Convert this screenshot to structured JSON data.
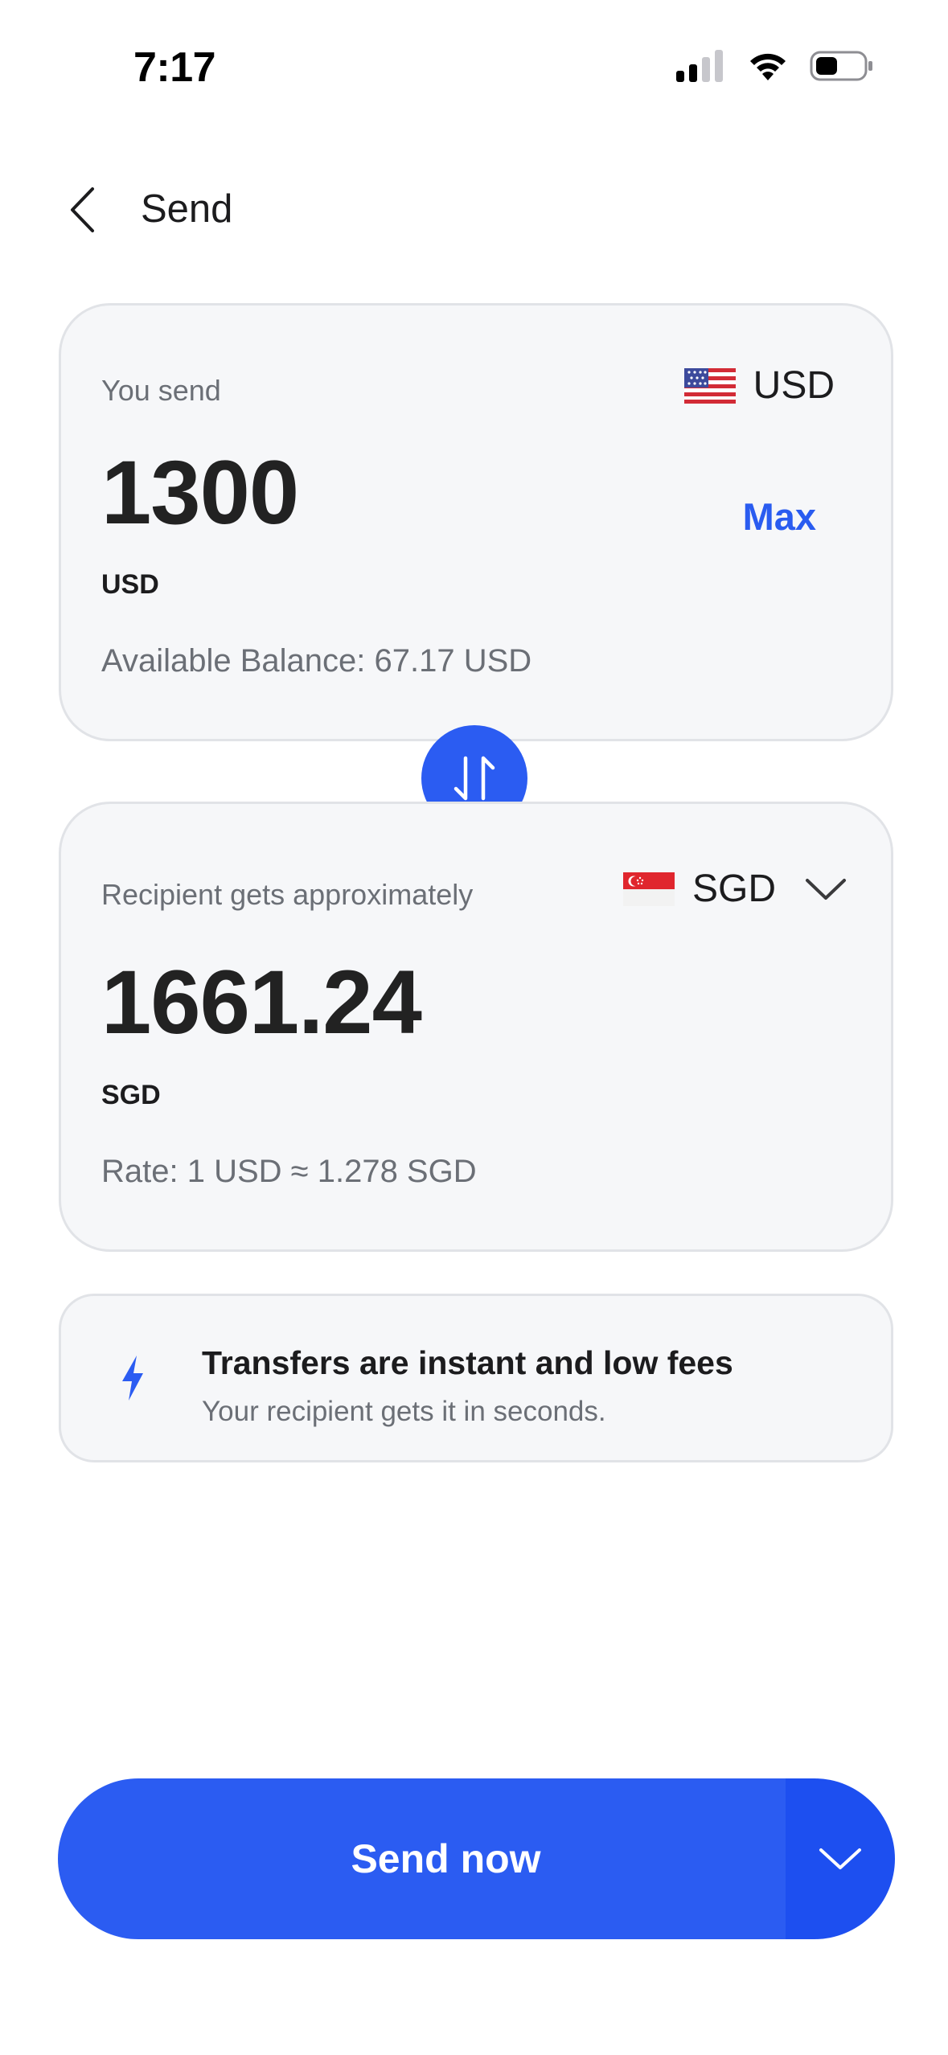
{
  "status_bar": {
    "time": "7:17",
    "icons": [
      "cellular-signal-icon",
      "wifi-icon",
      "battery-icon"
    ]
  },
  "header": {
    "title": "Send",
    "back_icon": "chevron-left-icon"
  },
  "send_card": {
    "label": "You send",
    "currency": "USD",
    "amount": "1300",
    "amount_unit": "USD",
    "max_label": "Max",
    "balance_text": "Available Balance: 67.17 USD",
    "flag": "us-flag-icon"
  },
  "swap": {
    "icon": "swap-arrows-icon"
  },
  "receive_card": {
    "label": "Recipient gets approximately",
    "currency": "SGD",
    "amount": "1661.24",
    "amount_unit": "SGD",
    "rate_text": "Rate: 1 USD ≈ 1.278 SGD",
    "flag": "sg-flag-icon"
  },
  "info_card": {
    "title": "Transfers are instant and low fees",
    "subtitle": "Your recipient gets it in seconds.",
    "icon": "lightning-bolt-icon"
  },
  "footer": {
    "send_label": "Send now"
  },
  "colors": {
    "accent": "#2b5cf2",
    "card_bg": "#f6f7f9",
    "muted_text": "#6b6f76"
  }
}
